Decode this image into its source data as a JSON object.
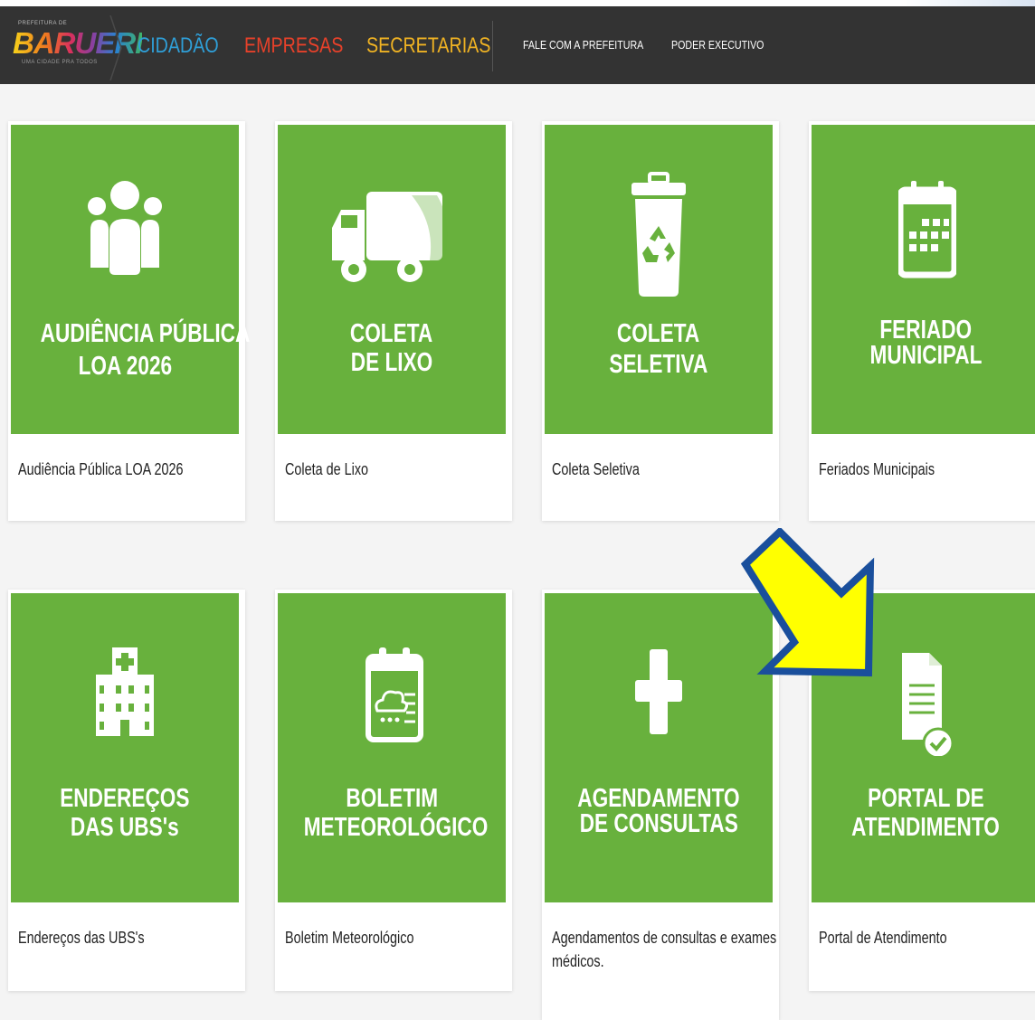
{
  "header": {
    "logo_small": "PREFEITURA DE",
    "logo_text": "BARUERI",
    "logo_tagline": "UMA CIDADE PRA TODOS",
    "nav": {
      "cidadao": "CIDADÃO",
      "empresas": "EMPRESAS",
      "secretarias": "SECRETARIAS",
      "fale": "FALE COM A PREFEITURA",
      "poder": "PODER EXECUTIVO"
    }
  },
  "colors": {
    "navbar_bg": "#333333",
    "tile_green": "#68b13d",
    "cidadao": "#2f9fd8",
    "empresas": "#e8412a",
    "secretarias": "#f0b323",
    "arrow_fill": "#ffff00",
    "arrow_outline": "#1a4f9c"
  },
  "cards": [
    {
      "icon": "people-icon",
      "title_line1": "AUDIÊNCIA PÚBLICA",
      "title_line2": "LOA 2026",
      "caption": "Audiência Pública LOA 2026"
    },
    {
      "icon": "garbage-truck-icon",
      "title_line1": "COLETA",
      "title_line2": "DE LIXO",
      "caption": "Coleta de Lixo"
    },
    {
      "icon": "recycle-bin-icon",
      "title_line1": "COLETA",
      "title_line2": "SELETIVA",
      "caption": "Coleta Seletiva"
    },
    {
      "icon": "calendar-icon",
      "title_line1": "FERIADO",
      "title_line2": "MUNICIPAL",
      "caption": "Feriados Municipais"
    },
    {
      "icon": "hospital-icon",
      "title_line1": "ENDEREÇOS",
      "title_line2": "DAS UBS's",
      "caption": "Endereços das UBS's"
    },
    {
      "icon": "weather-report-icon",
      "title_line1": "BOLETIM",
      "title_line2": "METEOROLÓGICO",
      "caption": "Boletim Meteorológico"
    },
    {
      "icon": "medical-cross-icon",
      "title_line1": "AGENDAMENTO",
      "title_line2": "DE CONSULTAS",
      "caption_line1": "Agendamentos de consultas e exames",
      "caption_line2": "médicos."
    },
    {
      "icon": "document-check-icon",
      "title_line1": "PORTAL DE",
      "title_line2": "ATENDIMENTO",
      "caption": "Portal de Atendimento"
    }
  ]
}
